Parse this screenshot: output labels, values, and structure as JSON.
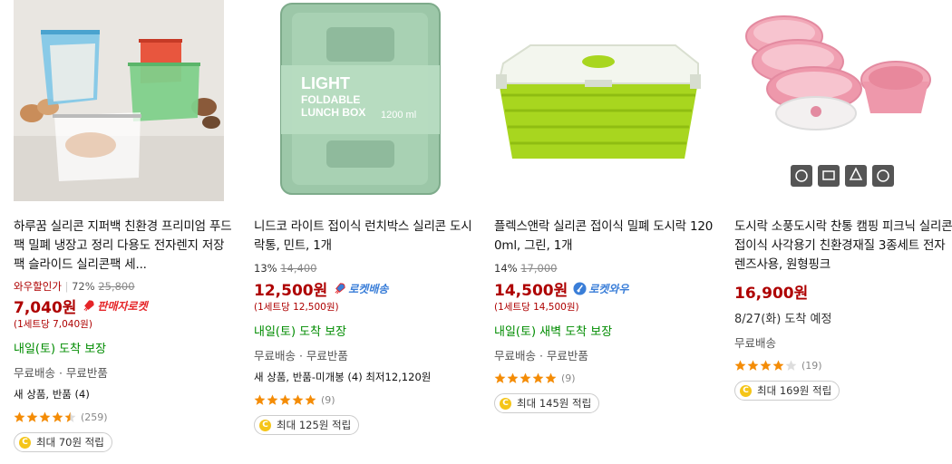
{
  "products": [
    {
      "title": "하루꿈 실리콘 지퍼백 친환경 프리미엄 푸드팩 밀폐 냉장고 정리 다용도 전자렌지 저장팩 슬라이드 실리콘팩 세...",
      "wow_label": "와우할인가",
      "wow_discount": "72%",
      "wow_original": "25,800",
      "price": "7,040원",
      "badge": "판매자로켓",
      "unit_price": "(1세트당 7,040원)",
      "delivery": "내일(토) 도착 보장",
      "shipping": "무료배송 · 무료반품",
      "extra": "새 상품, 반품 (4)",
      "rating": 4.5,
      "reviews": "(259)",
      "cashback": "최대 70원 적립"
    },
    {
      "title": "니드코 라이트 접이식 런치박스 실리콘 도시락통, 민트, 1개",
      "discount": "13%",
      "original": "14,400",
      "price": "12,500원",
      "badge": "로켓배송",
      "unit_price": "(1세트당 12,500원)",
      "delivery": "내일(토) 도착 보장",
      "shipping": "무료배송 · 무료반품",
      "extra": "새 상품, 반품-미개봉 (4) 최저12,120원",
      "rating": 5,
      "reviews": "(9)",
      "cashback": "최대 125원 적립"
    },
    {
      "title": "플렉스앤락 실리콘 접이식 밀폐 도시락 1200ml, 그린, 1개",
      "discount": "14%",
      "original": "17,000",
      "price": "14,500원",
      "badge": "로켓와우",
      "unit_price": "(1세트당 14,500원)",
      "delivery": "내일(토) 새벽 도착 보장",
      "shipping": "무료배송 · 무료반품",
      "rating": 5,
      "reviews": "(9)",
      "cashback": "최대 145원 적립"
    },
    {
      "title": "도시락 소풍도시락 찬통 캠핑 피크닉 실리콘 접이식 사각용기 친환경재질 3종세트 전자렌즈사용, 원형핑크",
      "price": "16,900원",
      "delivery": "8/27(화) 도착 예정",
      "shipping": "무료배송",
      "rating": 4,
      "reviews": "(19)",
      "cashback": "최대 169원 적립"
    }
  ],
  "colors": {
    "price_red": "#ae0000",
    "delivery_green": "#008c00",
    "rocket_blue": "#3a7ed8",
    "seller_rocket_red": "#e52528",
    "star_orange": "#f48c06"
  }
}
